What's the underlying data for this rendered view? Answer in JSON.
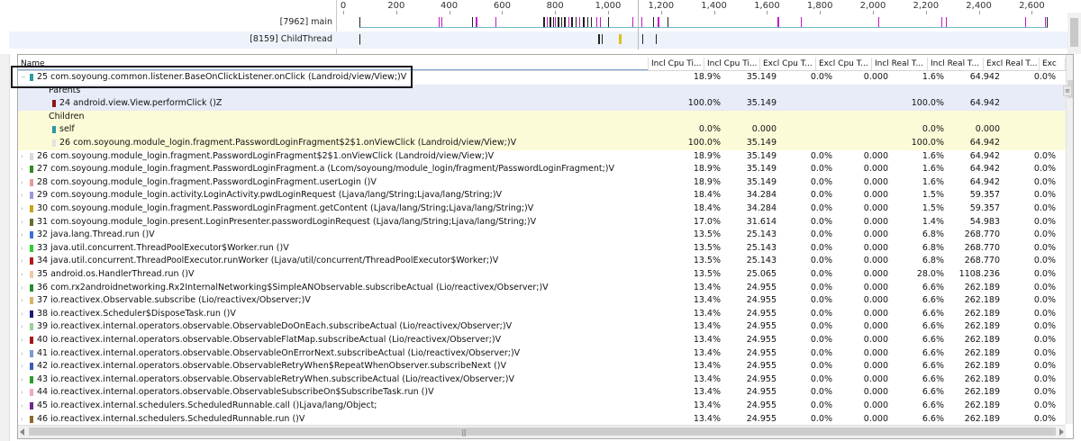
{
  "timeline": {
    "ruler_labels": [
      "0",
      "200",
      "400",
      "600",
      "800",
      "1,000",
      "1,200",
      "1,400",
      "1,600",
      "1,800",
      "2,000",
      "2,200",
      "2,400",
      "2,600"
    ],
    "threads": [
      {
        "name": "[7962] main"
      },
      {
        "name": "[8159] ChildThread"
      }
    ]
  },
  "table": {
    "columns": [
      "Name",
      "Incl Cpu Ti...",
      "Incl Cpu Ti...",
      "Excl Cpu T...",
      "Excl Cpu T...",
      "Incl Real T...",
      "Incl Real T...",
      "Excl Real T...",
      "Exc"
    ],
    "rows": [
      {
        "kind": "method",
        "expander": "−",
        "color": "#2c9aa0",
        "label": "25 com.soyoung.common.listener.BaseOnClickListener.onClick (Landroid/view/View;)V",
        "v": [
          "18.9%",
          "35.149",
          "0.0%",
          "0.000",
          "1.6%",
          "64.942",
          "0.0%"
        ]
      },
      {
        "kind": "parents-hdr",
        "label": "Parents",
        "v": [
          "",
          "",
          "",
          "",
          "",
          "",
          ""
        ]
      },
      {
        "kind": "parent-item",
        "color": "#8b1a1a",
        "label": "24 android.view.View.performClick ()Z",
        "v": [
          "100.0%",
          "35.149",
          "",
          "",
          "100.0%",
          "64.942",
          ""
        ]
      },
      {
        "kind": "children-hdr",
        "label": "Children",
        "v": [
          "",
          "",
          "",
          "",
          "",
          "",
          ""
        ]
      },
      {
        "kind": "child-item",
        "color": "#2c9aa0",
        "label": "self",
        "v": [
          "0.0%",
          "0.000",
          "",
          "",
          "0.0%",
          "0.000",
          ""
        ]
      },
      {
        "kind": "child-item",
        "color": "#e3e3e3",
        "label": "26 com.soyoung.module_login.fragment.PasswordLoginFragment$2$1.onViewClick (Landroid/view/View;)V",
        "v": [
          "100.0%",
          "35.149",
          "",
          "",
          "100.0%",
          "64.942",
          ""
        ]
      },
      {
        "kind": "method",
        "expander": "›",
        "color": "#d9d9d9",
        "label": "26 com.soyoung.module_login.fragment.PasswordLoginFragment$2$1.onViewClick (Landroid/view/View;)V",
        "v": [
          "18.9%",
          "35.149",
          "0.0%",
          "0.000",
          "1.6%",
          "64.942",
          "0.0%"
        ]
      },
      {
        "kind": "method",
        "expander": "›",
        "color": "#2f8c1e",
        "label": "27 com.soyoung.module_login.fragment.PasswordLoginFragment.a (Lcom/soyoung/module_login/fragment/PasswordLoginFragment;)V",
        "v": [
          "18.9%",
          "35.149",
          "0.0%",
          "0.000",
          "1.6%",
          "64.942",
          "0.0%"
        ]
      },
      {
        "kind": "method",
        "expander": "›",
        "color": "#e89a9a",
        "label": "28 com.soyoung.module_login.fragment.PasswordLoginFragment.userLogin ()V",
        "v": [
          "18.9%",
          "35.149",
          "0.0%",
          "0.000",
          "1.6%",
          "64.942",
          "0.0%"
        ]
      },
      {
        "kind": "method",
        "expander": "›",
        "color": "#9a9ad8",
        "label": "29 com.soyoung.module_login.activity.LoginActivity.pwdLoginRequest (Ljava/lang/String;Ljava/lang/String;)V",
        "v": [
          "18.4%",
          "34.284",
          "0.0%",
          "0.000",
          "1.5%",
          "59.357",
          "0.0%"
        ]
      },
      {
        "kind": "method",
        "expander": "›",
        "color": "#c9a21c",
        "label": "30 com.soyoung.module_login.fragment.PasswordLoginFragment.getContent (Ljava/lang/String;Ljava/lang/String;)V",
        "v": [
          "18.4%",
          "34.284",
          "0.0%",
          "0.000",
          "1.5%",
          "59.357",
          "0.0%"
        ]
      },
      {
        "kind": "method",
        "expander": "›",
        "color": "#6b6b2a",
        "label": "31 com.soyoung.module_login.present.LoginPresenter.passwordLoginRequest (Ljava/lang/String;Ljava/lang/String;)V",
        "v": [
          "17.0%",
          "31.614",
          "0.0%",
          "0.000",
          "1.4%",
          "54.983",
          "0.0%"
        ]
      },
      {
        "kind": "method",
        "expander": "›",
        "color": "#3f6fd4",
        "label": "32 java.lang.Thread.run ()V",
        "v": [
          "13.5%",
          "25.143",
          "0.0%",
          "0.000",
          "6.8%",
          "268.770",
          "0.0%"
        ]
      },
      {
        "kind": "method",
        "expander": "›",
        "color": "#2fcc2f",
        "label": "33 java.util.concurrent.ThreadPoolExecutor$Worker.run ()V",
        "v": [
          "13.5%",
          "25.143",
          "0.0%",
          "0.000",
          "6.8%",
          "268.770",
          "0.0%"
        ]
      },
      {
        "kind": "method",
        "expander": "›",
        "color": "#b01a1a",
        "label": "34 java.util.concurrent.ThreadPoolExecutor.runWorker (Ljava/util/concurrent/ThreadPoolExecutor$Worker;)V",
        "v": [
          "13.5%",
          "25.143",
          "0.0%",
          "0.000",
          "6.8%",
          "268.770",
          "0.0%"
        ]
      },
      {
        "kind": "method",
        "expander": "›",
        "color": "#f0c8a8",
        "label": "35 android.os.HandlerThread.run ()V",
        "v": [
          "13.5%",
          "25.065",
          "0.0%",
          "0.000",
          "28.0%",
          "1108.236",
          "0.0%"
        ]
      },
      {
        "kind": "method",
        "expander": "›",
        "color": "#2a8a2a",
        "label": "36 com.rx2androidnetworking.Rx2InternalNetworking$SimpleANObservable.subscribeActual (Lio/reactivex/Observer;)V",
        "v": [
          "13.4%",
          "24.955",
          "0.0%",
          "0.000",
          "6.6%",
          "262.189",
          "0.0%"
        ]
      },
      {
        "kind": "method",
        "expander": "›",
        "color": "#d9b26a",
        "label": "37 io.reactivex.Observable.subscribe (Lio/reactivex/Observer;)V",
        "v": [
          "13.4%",
          "24.955",
          "0.0%",
          "0.000",
          "6.6%",
          "262.189",
          "0.0%"
        ]
      },
      {
        "kind": "method",
        "expander": "›",
        "color": "#1a1a7a",
        "label": "38 io.reactivex.Scheduler$DisposeTask.run ()V",
        "v": [
          "13.4%",
          "24.955",
          "0.0%",
          "0.000",
          "6.6%",
          "262.189",
          "0.0%"
        ]
      },
      {
        "kind": "method",
        "expander": "›",
        "color": "#9ad09a",
        "label": "39 io.reactivex.internal.operators.observable.ObservableDoOnEach.subscribeActual (Lio/reactivex/Observer;)V",
        "v": [
          "13.4%",
          "24.955",
          "0.0%",
          "0.000",
          "6.6%",
          "262.189",
          "0.0%"
        ]
      },
      {
        "kind": "method",
        "expander": "›",
        "color": "#a01a1a",
        "label": "40 io.reactivex.internal.operators.observable.ObservableFlatMap.subscribeActual (Lio/reactivex/Observer;)V",
        "v": [
          "13.4%",
          "24.955",
          "0.0%",
          "0.000",
          "6.6%",
          "262.189",
          "0.0%"
        ]
      },
      {
        "kind": "method",
        "expander": "›",
        "color": "#7a9ad0",
        "label": "41 io.reactivex.internal.operators.observable.ObservableOnErrorNext.subscribeActual (Lio/reactivex/Observer;)V",
        "v": [
          "13.4%",
          "24.955",
          "0.0%",
          "0.000",
          "6.6%",
          "262.189",
          "0.0%"
        ]
      },
      {
        "kind": "method",
        "expander": "›",
        "color": "#3a5ab8",
        "label": "42 io.reactivex.internal.operators.observable.ObservableRetryWhen$RepeatWhenObserver.subscribeNext ()V",
        "v": [
          "13.4%",
          "24.955",
          "0.0%",
          "0.000",
          "6.6%",
          "262.189",
          "0.0%"
        ]
      },
      {
        "kind": "method",
        "expander": "›",
        "color": "#2a9a2a",
        "label": "43 io.reactivex.internal.operators.observable.ObservableRetryWhen.subscribeActual (Lio/reactivex/Observer;)V",
        "v": [
          "13.4%",
          "24.955",
          "0.0%",
          "0.000",
          "6.6%",
          "262.189",
          "0.0%"
        ]
      },
      {
        "kind": "method",
        "expander": "›",
        "color": "#f0a8c0",
        "label": "44 io.reactivex.internal.operators.observable.ObservableSubscribeOn$SubscribeTask.run ()V",
        "v": [
          "13.4%",
          "24.955",
          "0.0%",
          "0.000",
          "6.6%",
          "262.189",
          "0.0%"
        ]
      },
      {
        "kind": "method",
        "expander": "›",
        "color": "#6a2a8a",
        "label": "45 io.reactivex.internal.schedulers.ScheduledRunnable.call ()Ljava/lang/Object;",
        "v": [
          "13.4%",
          "24.955",
          "0.0%",
          "0.000",
          "6.6%",
          "262.189",
          "0.0%"
        ]
      },
      {
        "kind": "method",
        "expander": "›",
        "color": "#8a6a2a",
        "label": "46 io.reactivex.internal.schedulers.ScheduledRunnable.run ()V",
        "v": [
          "13.4%",
          "24.955",
          "0.0%",
          "0.000",
          "6.6%",
          "262.189",
          "0.0%"
        ]
      }
    ]
  },
  "scrollbar": {
    "grip": "|||"
  },
  "colors": {
    "selection_border": "#1a1a1a",
    "parents_bg": "#e8ebf8",
    "children_bg": "#fbfbd8"
  }
}
